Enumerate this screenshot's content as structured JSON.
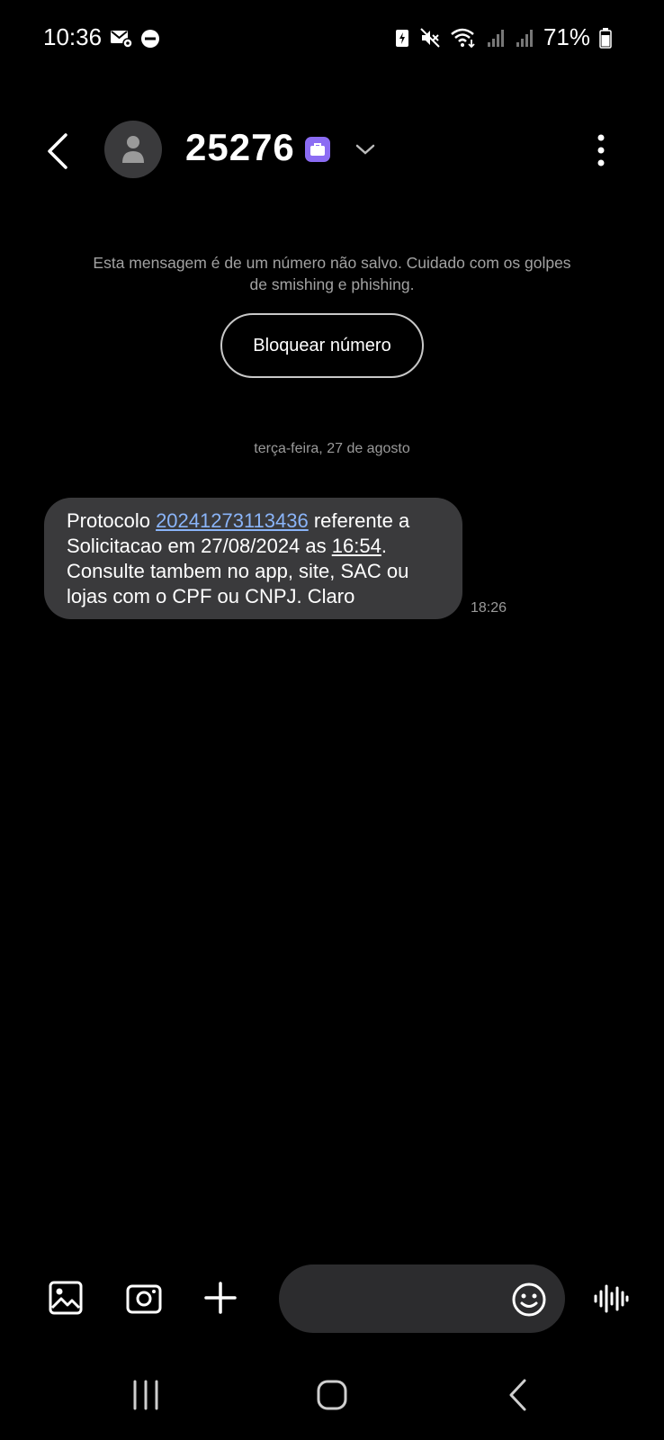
{
  "status_bar": {
    "time": "10:36",
    "battery": "71%",
    "icons": [
      "message-settings-icon",
      "do-not-disturb-icon",
      "battery-saver-icon",
      "mute-icon",
      "wifi-icon",
      "signal-icon",
      "signal-icon",
      "battery-icon"
    ]
  },
  "header": {
    "contact_name": "25276",
    "back_icon": "back-arrow-icon",
    "avatar_icon": "person-icon",
    "badge_icon": "business-briefcase-icon",
    "dropdown_icon": "chevron-down-icon",
    "menu_icon": "more-vertical-icon"
  },
  "warning": {
    "text": "Esta mensagem é de um número não salvo. Cuidado com os golpes de smishing e phishing.",
    "block_button": "Bloquear número"
  },
  "conversation": {
    "date_separator": "terça-feira, 27 de agosto",
    "messages": [
      {
        "part1": "Protocolo ",
        "protocol_link": "20241273113436",
        "part2": " referente a Solicitacao em 27/08/2024 as ",
        "time_link": "16:54",
        "part3": ". Consulte tambem no app, site, SAC ou lojas com o CPF ou CNPJ. Claro",
        "time": "18:26"
      }
    ]
  },
  "composer": {
    "placeholder": "",
    "icons": [
      "gallery-icon",
      "camera-icon",
      "plus-icon",
      "emoji-icon",
      "voice-record-icon"
    ]
  },
  "nav_bar": {
    "icons": [
      "recent-apps-icon",
      "home-icon",
      "back-icon"
    ]
  },
  "colors": {
    "background": "#000000",
    "bubble": "#3a3a3c",
    "link": "#8ab4f8",
    "badge": "#8b6cf3",
    "muted_text": "#a2a2a2"
  }
}
